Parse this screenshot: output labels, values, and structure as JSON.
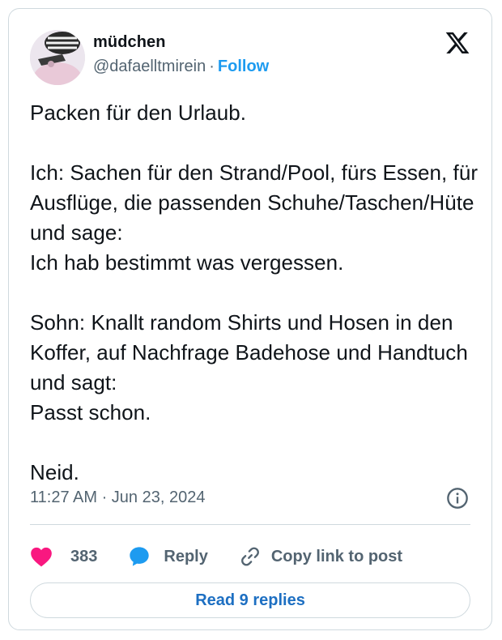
{
  "author": {
    "display_name": "müdchen",
    "handle": "@dafaelltmirein",
    "separator": "·",
    "follow_label": "Follow"
  },
  "tweet": {
    "text": "Packen für den Urlaub.\n\nIch: Sachen für den Strand/Pool, fürs Essen, für Ausflüge, die passenden Schuhe/Taschen/Hüte und sage:\nIch hab bestimmt was vergessen.\n\nSohn: Knallt random Shirts und Hosen in den Koffer, auf Nachfrage Badehose und Handtuch und sagt:\nPasst schon.\n\nNeid.",
    "timestamp": "11:27 AM · Jun 23, 2024"
  },
  "actions": {
    "like_count": "383",
    "reply_label": "Reply",
    "copy_label": "Copy link to post"
  },
  "read_replies_label": "Read 9 replies",
  "icons": {
    "brand": "x-logo-icon",
    "info": "info-icon",
    "like": "heart-icon",
    "reply": "speech-bubble-icon",
    "copy": "link-icon"
  },
  "colors": {
    "accent": "#1d9bf0",
    "like": "#f91880",
    "secondary_text": "#536471",
    "border": "#cfd9de"
  }
}
